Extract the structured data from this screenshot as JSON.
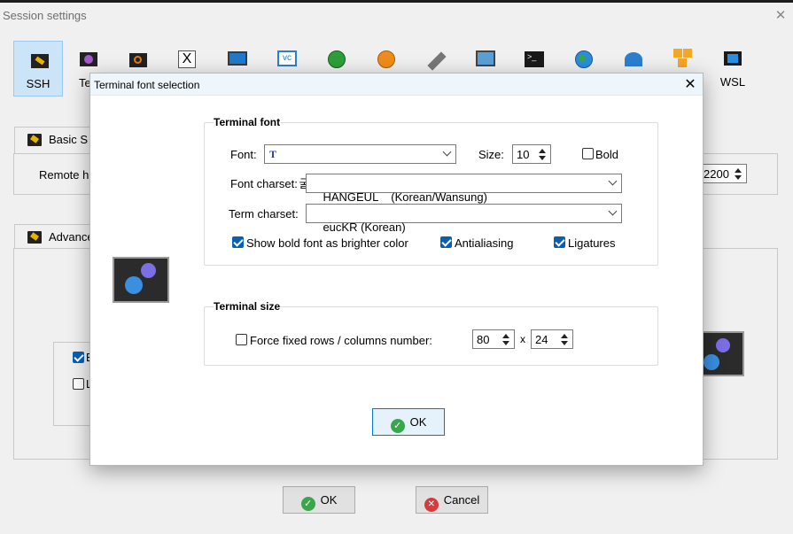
{
  "window": {
    "title": "Session settings",
    "close": "✕"
  },
  "session_types": [
    {
      "label": "SSH",
      "icon": "ssh-key-icon",
      "selected": true
    },
    {
      "label": "Tel",
      "icon": "telnet-icon"
    },
    {
      "label": "",
      "icon": "rsh-icon"
    },
    {
      "label": "",
      "icon": "xdmcp-icon"
    },
    {
      "label": "",
      "icon": "rdp-icon"
    },
    {
      "label": "",
      "icon": "vnc-icon"
    },
    {
      "label": "",
      "icon": "ftp-icon"
    },
    {
      "label": "",
      "icon": "sftp-icon"
    },
    {
      "label": "",
      "icon": "serial-icon"
    },
    {
      "label": "",
      "icon": "file-icon"
    },
    {
      "label": "",
      "icon": "shell-icon"
    },
    {
      "label": "",
      "icon": "browser-icon"
    },
    {
      "label": "",
      "icon": "mosh-icon"
    },
    {
      "label": "",
      "icon": "aws-s3-icon"
    },
    {
      "label": "WSL",
      "icon": "windows-icon"
    }
  ],
  "basic": {
    "tab": "Basic S",
    "remote_host_label": "Remote h",
    "port": "2200"
  },
  "advanced": {
    "tab": "Advance",
    "opt1": "E",
    "opt2": "L"
  },
  "main_buttons": {
    "ok": "OK",
    "cancel": "Cancel"
  },
  "dialog": {
    "title": "Terminal font selection",
    "close": "✕",
    "terminal_font": {
      "legend": "Terminal font",
      "font_label": "Font:",
      "font_value": "굴림체",
      "size_label": "Size:",
      "size_value": "10",
      "bold_label": "Bold",
      "bold_checked": false,
      "charset_label": "Font charset:",
      "charset_value": "HANGEUL    (Korean/Wansung)",
      "term_charset_label": "Term charset:",
      "term_charset_value": "eucKR (Korean)",
      "bright_bold_label": "Show bold font as brighter color",
      "bright_bold_checked": true,
      "antialiasing_label": "Antialiasing",
      "antialiasing_checked": true,
      "ligatures_label": "Ligatures",
      "ligatures_checked": true
    },
    "terminal_size": {
      "legend": "Terminal size",
      "force_label": "Force fixed rows / columns number:",
      "force_checked": false,
      "cols": "80",
      "x_label": "x",
      "rows": "24"
    },
    "ok": "OK"
  },
  "colors": {
    "accent": "#0a5fb3",
    "selected_bg": "#cce4f7",
    "ok_green": "#3aa64b",
    "cancel_red": "#d83b3b"
  }
}
